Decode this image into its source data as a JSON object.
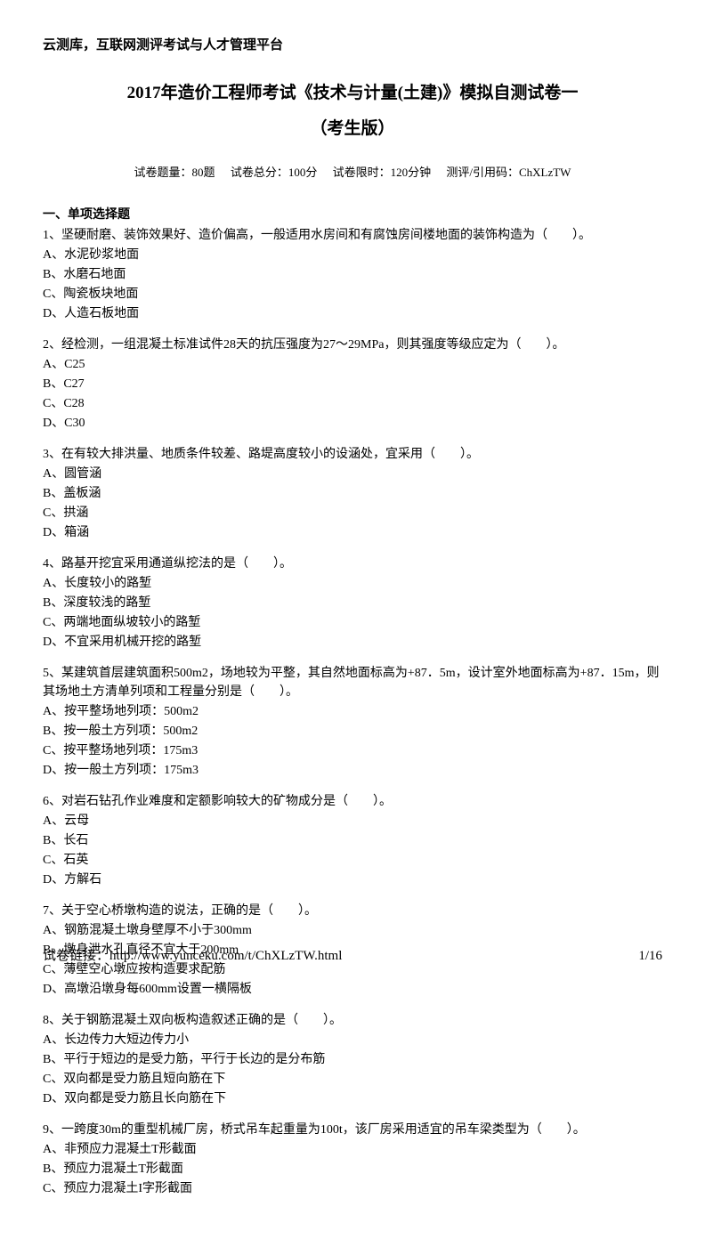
{
  "header": "云测库，互联网测评考试与人才管理平台",
  "title": "2017年造价工程师考试《技术与计量(土建)》模拟自测试卷一",
  "subtitle": "（考生版）",
  "meta": {
    "count": "试卷题量：80题",
    "score": "试卷总分：100分",
    "time": "试卷限时：120分钟",
    "code": "测评/引用码：ChXLzTW"
  },
  "section1_title": "一、单项选择题",
  "questions": [
    {
      "text": "1、坚硬耐磨、装饰效果好、造价偏高，一般适用水房间和有腐蚀房间楼地面的装饰构造为（　　）。",
      "options": [
        "A、水泥砂浆地面",
        "B、水磨石地面",
        "C、陶瓷板块地面",
        "D、人造石板地面"
      ]
    },
    {
      "text": "2、经检测，一组混凝土标准试件28天的抗压强度为27～29MPa，则其强度等级应定为（　　）。",
      "options": [
        "A、C25",
        "B、C27",
        "C、C28",
        "D、C30"
      ]
    },
    {
      "text": "3、在有较大排洪量、地质条件较差、路堤高度较小的设涵处，宜采用（　　）。",
      "options": [
        "A、圆管涵",
        "B、盖板涵",
        "C、拱涵",
        "D、箱涵"
      ]
    },
    {
      "text": "4、路基开挖宜采用通道纵挖法的是（　　）。",
      "options": [
        "A、长度较小的路堑",
        "B、深度较浅的路堑",
        "C、两端地面纵坡较小的路堑",
        "D、不宜采用机械开挖的路堑"
      ]
    },
    {
      "text": "5、某建筑首层建筑面积500m2，场地较为平整，其自然地面标高为+87．5m，设计室外地面标高为+87．15m，则其场地土方清单列项和工程量分别是（　　）。",
      "options": [
        "A、按平整场地列项：500m2",
        "B、按一般土方列项：500m2",
        "C、按平整场地列项：175m3",
        "D、按一般土方列项：175m3"
      ]
    },
    {
      "text": "6、对岩石钻孔作业难度和定额影响较大的矿物成分是（　　）。",
      "options": [
        "A、云母",
        "B、长石",
        "C、石英",
        "D、方解石"
      ]
    },
    {
      "text": "7、关于空心桥墩构造的说法，正确的是（　　）。",
      "options": [
        "A、钢筋混凝土墩身壁厚不小于300mm",
        "B、墩身泄水孔直径不宜大于200mm",
        "C、薄壁空心墩应按构造要求配筋",
        "D、高墩沿墩身每600mm设置一横隔板"
      ]
    },
    {
      "text": "8、关于钢筋混凝土双向板构造叙述正确的是（　　）。",
      "options": [
        "A、长边传力大短边传力小",
        "B、平行于短边的是受力筋，平行于长边的是分布筋",
        "C、双向都是受力筋且短向筋在下",
        "D、双向都是受力筋且长向筋在下"
      ]
    },
    {
      "text": "9、一跨度30m的重型机械厂房，桥式吊车起重量为100t，该厂房采用适宜的吊车梁类型为（　　）。",
      "options": [
        "A、非预应力混凝土T形截面",
        "B、预应力混凝土T形截面",
        "C、预应力混凝土I字形截面"
      ]
    }
  ],
  "footer": {
    "link": "试卷链接：http://www.yunceku.com/t/ChXLzTW.html",
    "page": "1/16"
  }
}
